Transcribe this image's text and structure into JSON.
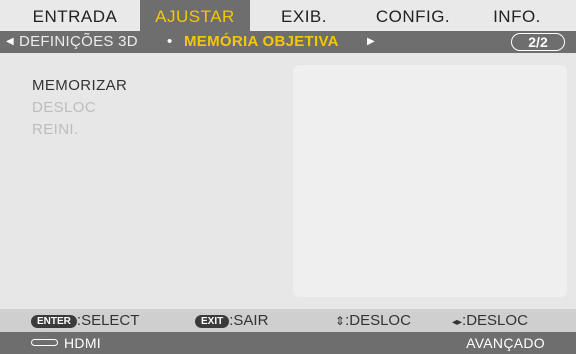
{
  "tabs": [
    {
      "label": "ENTRADA",
      "active": false
    },
    {
      "label": "AJUSTAR",
      "active": true
    },
    {
      "label": "EXIB.",
      "active": false
    },
    {
      "label": "CONFIG.",
      "active": false
    },
    {
      "label": "INFO.",
      "active": false
    }
  ],
  "breadcrumb": {
    "left_arrow": "◀",
    "parent": "DEFINIÇÕES 3D",
    "separator": "•",
    "current": "MEMÓRIA OBJETIVA",
    "right_arrow": "▶",
    "page_indicator": "2/2"
  },
  "menu": [
    {
      "label": "MEMORIZAR",
      "enabled": true
    },
    {
      "label": "DESLOC",
      "enabled": false
    },
    {
      "label": "REINI.",
      "enabled": false
    }
  ],
  "help": [
    {
      "key": "ENTER",
      "text": ":SELECT"
    },
    {
      "key": "EXIT",
      "text": ":SAIR"
    },
    {
      "key": "⇕",
      "text": ":DESLOC"
    },
    {
      "key": "◂▸",
      "text": ":DESLOC"
    }
  ],
  "status": {
    "icon": "hdmi-connector-icon",
    "source": "HDMI",
    "mode": "AVANÇADO"
  },
  "colors": {
    "highlight": "#f4c800",
    "bar": "#6e6e6e",
    "background": "#e7e7e7"
  }
}
